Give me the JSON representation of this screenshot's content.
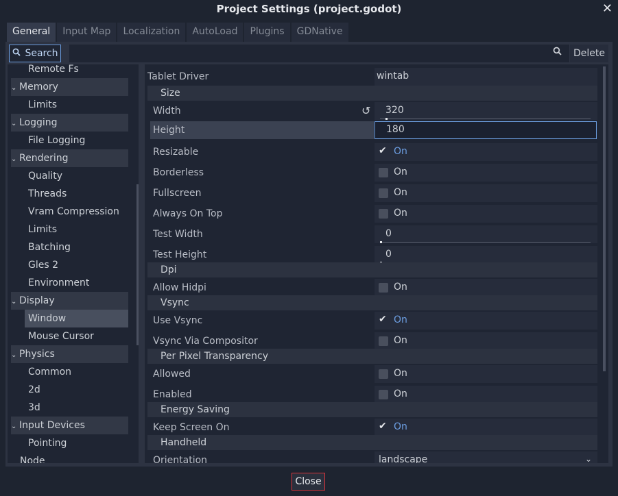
{
  "window": {
    "title": "Project Settings (project.godot)",
    "close_glyph": "✕"
  },
  "tabs": [
    {
      "label": "General",
      "active": true
    },
    {
      "label": "Input Map"
    },
    {
      "label": "Localization"
    },
    {
      "label": "AutoLoad"
    },
    {
      "label": "Plugins"
    },
    {
      "label": "GDNative"
    }
  ],
  "toolbar": {
    "search_label": "Search",
    "delete_label": "Delete"
  },
  "sidebar": {
    "items": [
      {
        "label": "Remote Fs"
      },
      {
        "label": "Memory"
      },
      {
        "label": "Limits"
      },
      {
        "label": "Logging"
      },
      {
        "label": "File Logging"
      },
      {
        "label": "Rendering"
      },
      {
        "label": "Quality"
      },
      {
        "label": "Threads"
      },
      {
        "label": "Vram Compression"
      },
      {
        "label": "Limits"
      },
      {
        "label": "Batching"
      },
      {
        "label": "Gles 2"
      },
      {
        "label": "Environment"
      },
      {
        "label": "Display"
      },
      {
        "label": "Window"
      },
      {
        "label": "Mouse Cursor"
      },
      {
        "label": "Physics"
      },
      {
        "label": "Common"
      },
      {
        "label": "2d"
      },
      {
        "label": "3d"
      },
      {
        "label": "Input Devices"
      },
      {
        "label": "Pointing"
      },
      {
        "label": "Node"
      }
    ]
  },
  "props": {
    "tablet_driver": {
      "label": "Tablet Driver",
      "value": "wintab"
    },
    "size_group": "Size",
    "width": {
      "label": "Width",
      "value": "320"
    },
    "height": {
      "label": "Height",
      "value": "180"
    },
    "resizable": {
      "label": "Resizable",
      "value": "On",
      "checked": true
    },
    "borderless": {
      "label": "Borderless",
      "value": "On",
      "checked": false
    },
    "fullscreen": {
      "label": "Fullscreen",
      "value": "On",
      "checked": false
    },
    "always_on_top": {
      "label": "Always On Top",
      "value": "On",
      "checked": false
    },
    "test_width": {
      "label": "Test Width",
      "value": "0"
    },
    "test_height": {
      "label": "Test Height",
      "value": "0"
    },
    "dpi_group": "Dpi",
    "allow_hidpi": {
      "label": "Allow Hidpi",
      "value": "On",
      "checked": false
    },
    "vsync_group": "Vsync",
    "use_vsync": {
      "label": "Use Vsync",
      "value": "On",
      "checked": true
    },
    "vsync_via_compositor": {
      "label": "Vsync Via Compositor",
      "value": "On",
      "checked": false
    },
    "ppt_group": "Per Pixel Transparency",
    "allowed": {
      "label": "Allowed",
      "value": "On",
      "checked": false
    },
    "enabled": {
      "label": "Enabled",
      "value": "On",
      "checked": false
    },
    "energy_group": "Energy Saving",
    "keep_screen_on": {
      "label": "Keep Screen On",
      "value": "On",
      "checked": true
    },
    "handheld_group": "Handheld",
    "orientation": {
      "label": "Orientation",
      "value": "landscape"
    }
  },
  "footer": {
    "close_label": "Close"
  },
  "colors": {
    "accent": "#6c9ee0",
    "close_border": "#d9343a",
    "on_text": "#6d9fe3"
  }
}
